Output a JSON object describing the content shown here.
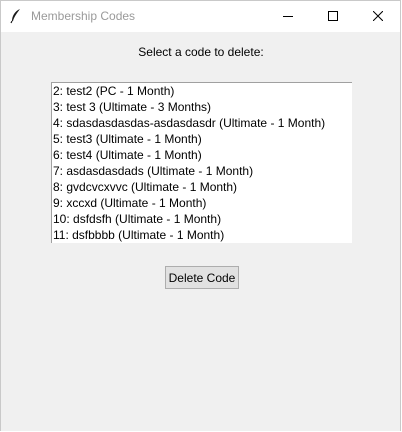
{
  "window": {
    "title": "Membership Codes",
    "icon": "feather-icon",
    "controls": [
      "minimize-icon",
      "maximize-icon",
      "close-icon"
    ]
  },
  "prompt": "Select a code to delete:",
  "codes": [
    "2: test2 (PC - 1 Month)",
    "3: test 3 (Ultimate - 3 Months)",
    "4: sdasdasdasdas-asdasdasdr (Ultimate - 1 Month)",
    "5: test3 (Ultimate - 1 Month)",
    "6: test4 (Ultimate - 1 Month)",
    "7: asdasdasdads (Ultimate - 1 Month)",
    "8: gvdcvcxvvc (Ultimate - 1 Month)",
    "9: xccxd (Ultimate - 1 Month)",
    "10: dsfdsfh (Ultimate - 1 Month)",
    "11: dsfbbbb (Ultimate - 1 Month)"
  ],
  "delete_button": "Delete Code"
}
